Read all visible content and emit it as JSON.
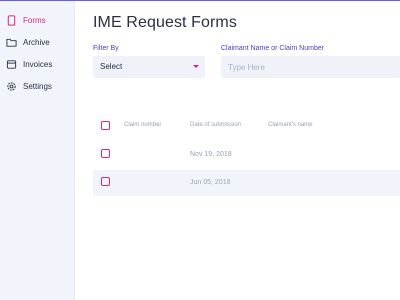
{
  "sidebar": {
    "items": [
      {
        "label": "Forms",
        "icon": "form-document-icon",
        "active": true
      },
      {
        "label": "Archive",
        "icon": "folder-icon",
        "active": false
      },
      {
        "label": "Invoices",
        "icon": "invoice-icon",
        "active": false
      },
      {
        "label": "Settings",
        "icon": "gear-icon",
        "active": false
      }
    ]
  },
  "page": {
    "title": "IME Request Forms"
  },
  "filters": {
    "filter_by_label": "Filter By",
    "filter_by_value": "Select",
    "claimant_label": "Claimant Name or Claim Number",
    "claimant_placeholder": "Type Here"
  },
  "table": {
    "columns": [
      "Claim number",
      "Date of submission",
      "Claimant's name"
    ],
    "rows": [
      {
        "claim_number": "",
        "date": "Nov 19, 2018",
        "claimant": ""
      },
      {
        "claim_number": "",
        "date": "Jun 05, 2018",
        "claimant": ""
      }
    ]
  },
  "colors": {
    "accent": "#d9267a",
    "label": "#4b3fbf",
    "sidebar_bg": "#f1f5fb"
  }
}
